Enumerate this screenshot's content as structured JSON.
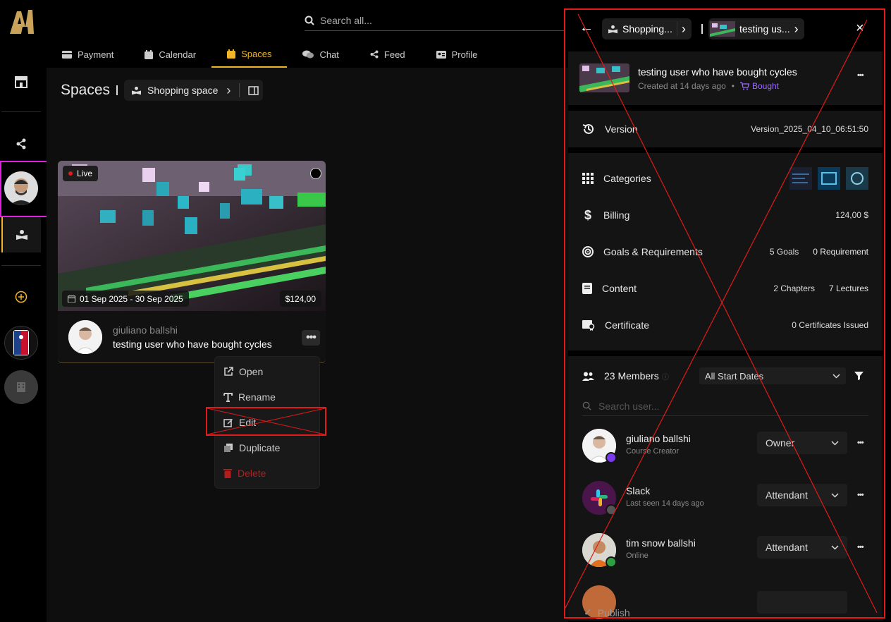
{
  "nav": {
    "tabs": [
      {
        "label": "Payment",
        "icon": "credit-card-icon"
      },
      {
        "label": "Calendar",
        "icon": "calendar-icon"
      },
      {
        "label": "Spaces",
        "icon": "calendar-icon"
      },
      {
        "label": "Chat",
        "icon": "chat-icon"
      },
      {
        "label": "Feed",
        "icon": "share-icon"
      },
      {
        "label": "Profile",
        "icon": "id-card-icon"
      }
    ],
    "active_tab": "Spaces"
  },
  "search": {
    "placeholder": "Search all..."
  },
  "page": {
    "title": "Spaces",
    "breadcrumb": "Shopping space"
  },
  "card": {
    "badge": "Live",
    "dates": "01 Sep 2025 - 30 Sep 2025",
    "price": "$124,00",
    "author": "giuliano ballshi",
    "title": "testing user who have bought cycles"
  },
  "context_menu": {
    "open": "Open",
    "rename": "Rename",
    "edit": "Edit",
    "duplicate": "Duplicate",
    "delete": "Delete"
  },
  "panel": {
    "crumb1": "Shopping...",
    "crumb2": "testing us...",
    "title": "testing user who have bought cycles",
    "created": "Created at 14 days ago",
    "status": "Bought",
    "version_label": "Version",
    "version_value": "Version_2025_04_10_06:51:50",
    "categories_label": "Categories",
    "billing_label": "Billing",
    "billing_value": "124,00 $",
    "goals_label": "Goals & Requirements",
    "goals_value": "5 Goals",
    "req_value": "0 Requirement",
    "content_label": "Content",
    "chapters_value": "2 Chapters",
    "lectures_value": "7 Lectures",
    "cert_label": "Certificate",
    "cert_value": "0 Certificates Issued",
    "members_label": "23 Members",
    "date_filter": "All Start Dates",
    "search_placeholder": "Search user...",
    "publish": "Publish"
  },
  "members": [
    {
      "name": "giuliano ballshi",
      "sub": "Course Creator",
      "role": "Owner"
    },
    {
      "name": "Slack",
      "sub": "Last seen 14 days ago",
      "role": "Attendant"
    },
    {
      "name": "tim snow ballshi",
      "sub": "Online",
      "role": "Attendant"
    }
  ],
  "colors": {
    "accent": "#f0b429",
    "live": "#e21a1a",
    "bought": "#9b6bff",
    "annotation": "#e21a1a",
    "highlight": "#e020e0"
  }
}
